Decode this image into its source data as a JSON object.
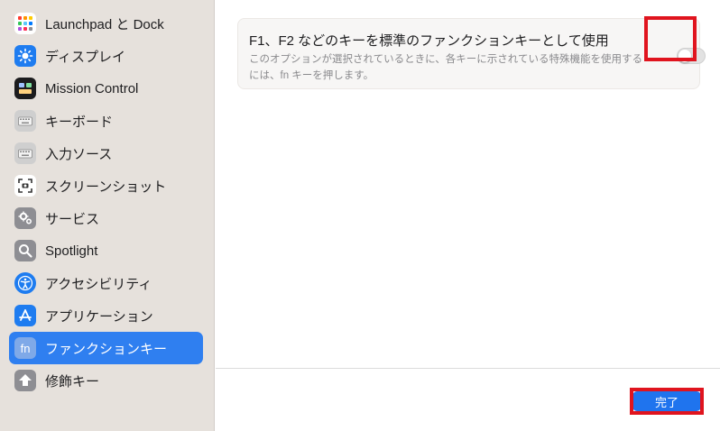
{
  "sidebar": {
    "items": [
      {
        "label": "Launchpad と Dock",
        "icon": "launchpad-icon",
        "color": "#ffffff"
      },
      {
        "label": "ディスプレイ",
        "icon": "display-icon",
        "color": "#1e7cf0"
      },
      {
        "label": "Mission Control",
        "icon": "mission-control-icon",
        "color": "#1c1c1e"
      },
      {
        "label": "キーボード",
        "icon": "keyboard-icon",
        "color": "#cfcfcf"
      },
      {
        "label": "入力ソース",
        "icon": "input-source-icon",
        "color": "#cfcfcf"
      },
      {
        "label": "スクリーンショット",
        "icon": "screenshot-icon",
        "color": "#ffffff"
      },
      {
        "label": "サービス",
        "icon": "gear-icon",
        "color": "#8e8e93"
      },
      {
        "label": "Spotlight",
        "icon": "search-icon",
        "color": "#8e8e93"
      },
      {
        "label": "アクセシビリティ",
        "icon": "accessibility-icon",
        "color": "#1e7cf0"
      },
      {
        "label": "アプリケーション",
        "icon": "app-store-icon",
        "color": "#1e7cf0"
      },
      {
        "label": "ファンクションキー",
        "icon": "fn-icon",
        "color": "#7fa9e8",
        "selected": true
      },
      {
        "label": "修飾キー",
        "icon": "modifier-key-icon",
        "color": "#8e8e93"
      }
    ]
  },
  "main": {
    "setting": {
      "title": "F1、F2 などのキーを標準のファンクションキーとして使用",
      "description": "このオプションが選択されているときに、各キーに示されている特殊機能を使用するには、fn キーを押します。",
      "toggle_on": false
    },
    "done_label": "完了"
  },
  "colors": {
    "accent": "#2f7ff0",
    "highlight_box": "#e0141e"
  },
  "icons": {
    "fn_text": "fn"
  }
}
